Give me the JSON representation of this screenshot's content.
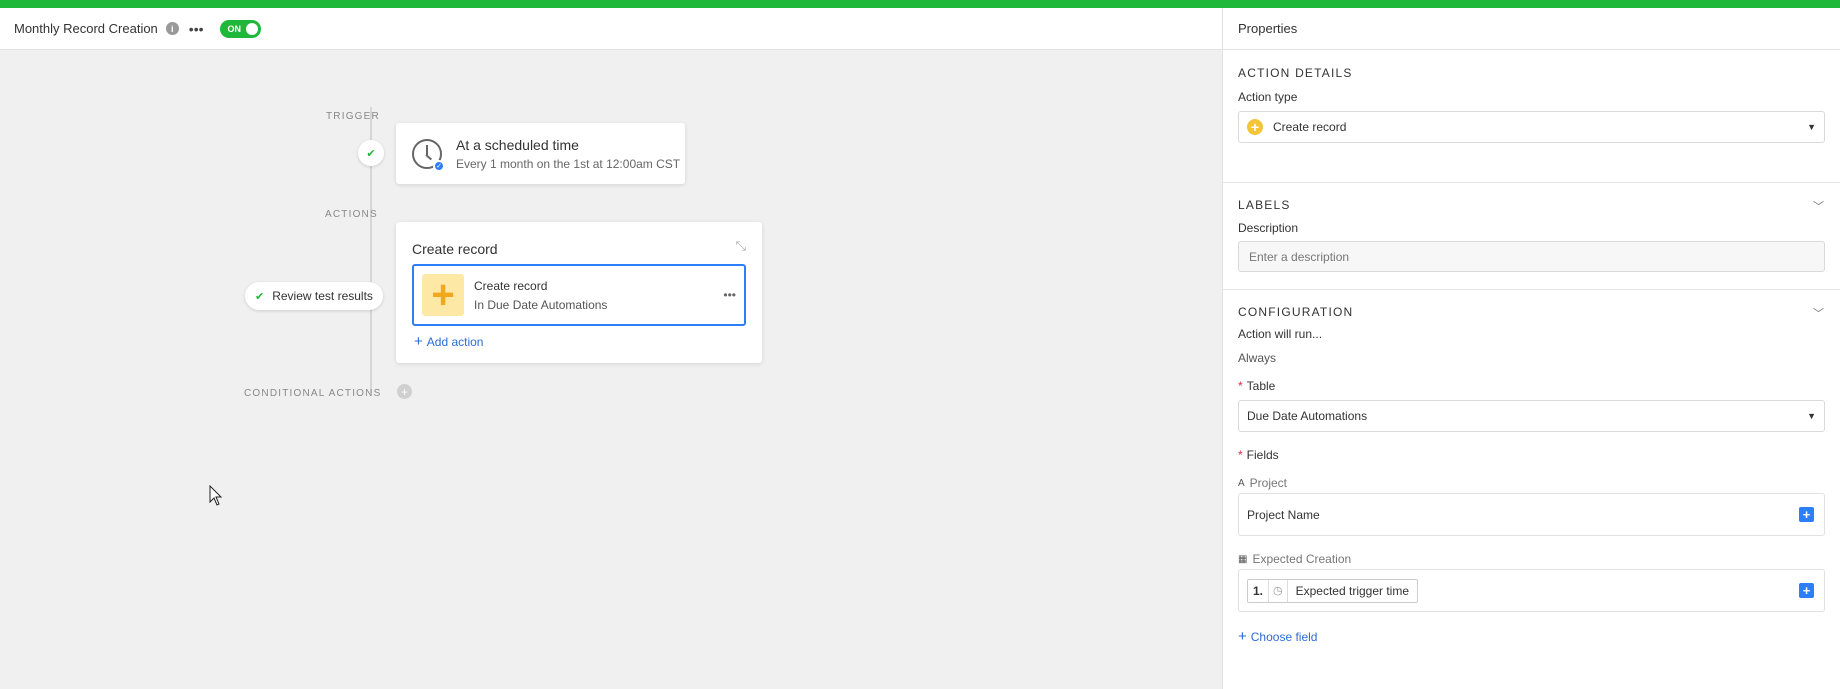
{
  "header": {
    "title": "Monthly Record Creation",
    "toggle_label": "ON"
  },
  "canvas": {
    "trigger_label": "TRIGGER",
    "actions_label": "ACTIONS",
    "conditional_label": "CONDITIONAL ACTIONS",
    "trigger_card": {
      "title": "At a scheduled time",
      "subtitle": "Every 1 month on the 1st at 12:00am CST"
    },
    "action_card": {
      "title": "Create record",
      "item_title": "Create record",
      "item_subtitle": "In Due Date Automations",
      "add_action": "Add action"
    },
    "review_pill": "Review test results"
  },
  "panel": {
    "title": "Properties",
    "action_details": {
      "heading": "ACTION DETAILS",
      "action_type_label": "Action type",
      "action_type_value": "Create record"
    },
    "labels": {
      "heading": "LABELS",
      "description_label": "Description",
      "description_placeholder": "Enter a description"
    },
    "configuration": {
      "heading": "CONFIGURATION",
      "will_run_label": "Action will run...",
      "will_run_value": "Always",
      "table_label": "Table",
      "table_value": "Due Date Automations",
      "fields_label": "Fields",
      "project_field_label": "Project",
      "project_field_value": "Project Name",
      "expected_field_label": "Expected Creation",
      "token_number": "1.",
      "token_text": "Expected trigger time",
      "choose_field": "Choose field"
    }
  },
  "colors": {
    "accent_green": "#20b83a",
    "accent_blue": "#2d7ff9",
    "plus_yellow": "#f3a71e"
  }
}
